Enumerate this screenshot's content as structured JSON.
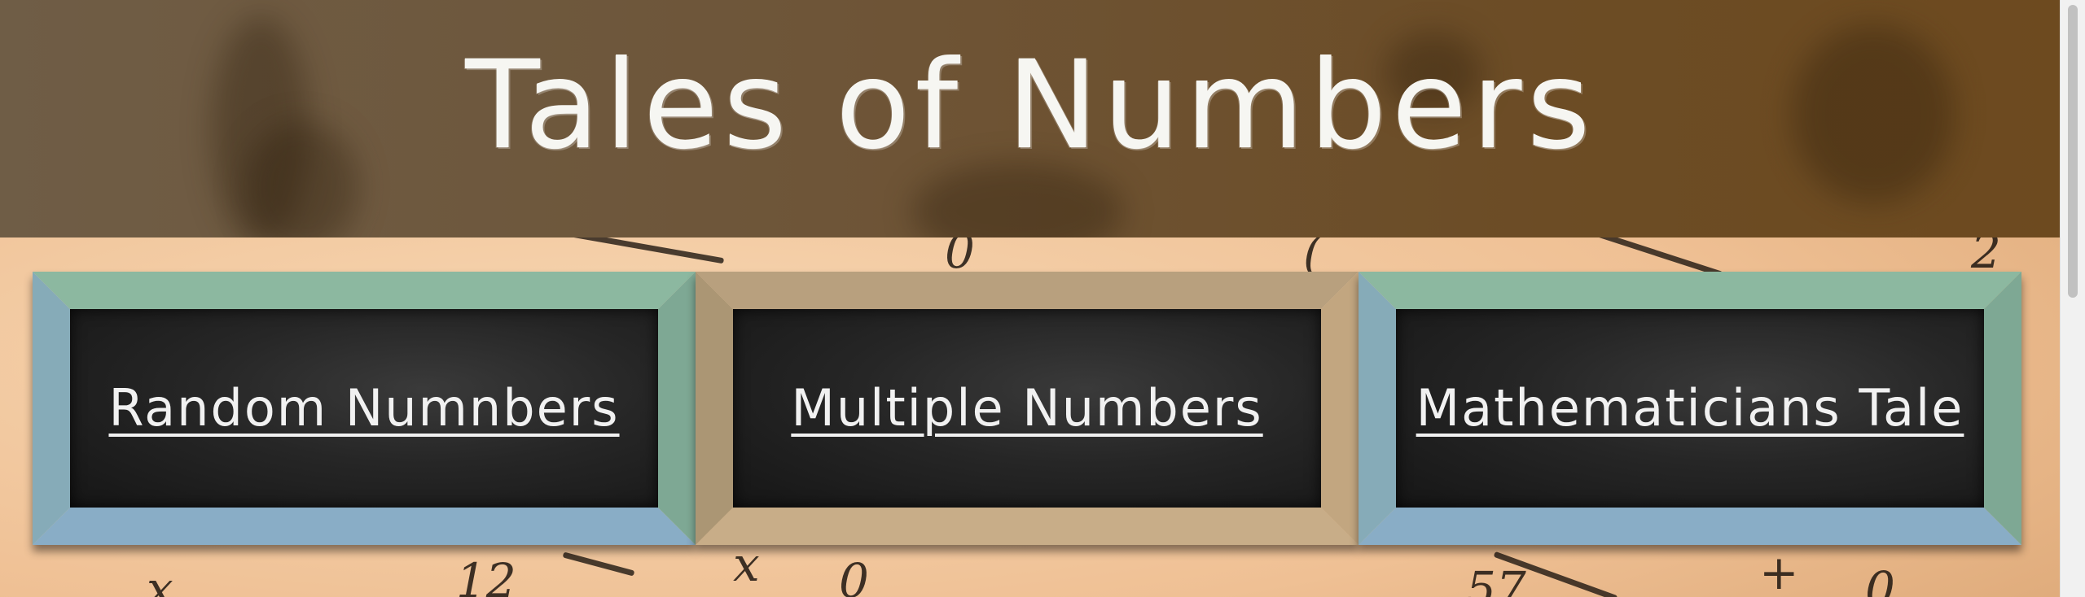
{
  "header": {
    "title": "Tales of Numbers"
  },
  "boards": [
    {
      "label": "Random Numnbers",
      "frame_color": "#8cb8a0",
      "frame_side_color": "#89a9c4"
    },
    {
      "label": "Multiple Numbers",
      "frame_color": "#b6a07e",
      "frame_side_color": "#c6ac86"
    },
    {
      "label": "Mathematicians Tale",
      "frame_color": "#8cb8a0",
      "frame_side_color": "#89a9c4"
    }
  ],
  "colors": {
    "header_bg": "#6e5538",
    "paper_bg": "#f2c9a0",
    "board_bg": "#1e1e1e",
    "text": "#f1f1f1"
  }
}
